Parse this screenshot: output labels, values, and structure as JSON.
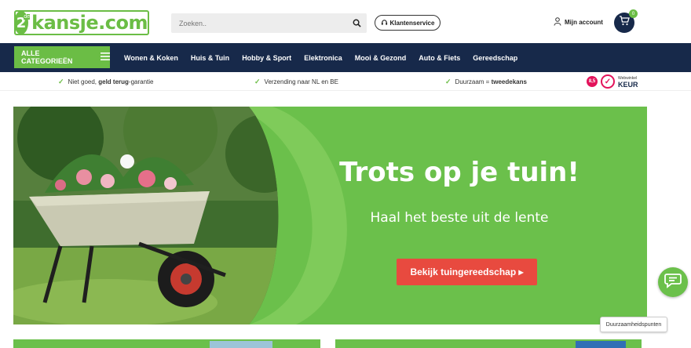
{
  "header": {
    "logo_number": "2",
    "logo_superscript": "de",
    "logo_text": "kansje.com",
    "search_placeholder": "Zoeken..",
    "service_label": "Klantenservice",
    "account_label": "Mijn account",
    "cart_count": "0"
  },
  "nav": {
    "categories_label": "ALLE CATEGORIEËN",
    "items": [
      {
        "label": "Wonen & Koken"
      },
      {
        "label": "Huis & Tuin"
      },
      {
        "label": "Hobby & Sport"
      },
      {
        "label": "Elektronica"
      },
      {
        "label": "Mooi & Gezond"
      },
      {
        "label": "Auto & Fiets"
      },
      {
        "label": "Gereedschap"
      }
    ]
  },
  "usp": {
    "item1_pre": "Niet goed, ",
    "item1_bold": "geld terug",
    "item1_post": "-garantie",
    "item2": "Verzending naar NL en BE",
    "item3_pre": "Duurzaam = ",
    "item3_bold": "tweedekans",
    "keur_score": "8,5",
    "keur_small": "Webwinkel",
    "keur_big": "KEUR"
  },
  "banner": {
    "title": "Trots op je tuin!",
    "subtitle": "Haal het beste uit de lente",
    "cta": "Bekijk tuingereedschap ▸"
  },
  "tooltip": "Duurzaamheidspunten",
  "colors": {
    "brand_green": "#6bbd45",
    "navy": "#17294a",
    "cta_red": "#e84a3f"
  }
}
